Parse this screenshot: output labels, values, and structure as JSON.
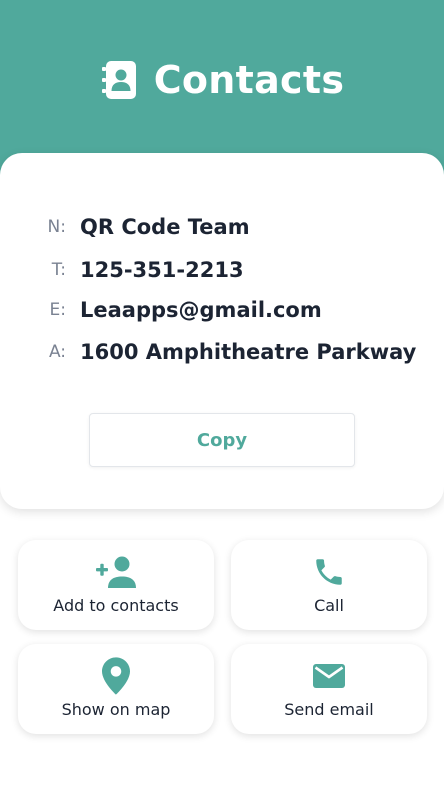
{
  "header": {
    "title": "Contacts",
    "icon": "contacts-book-icon",
    "color": "#50a99c"
  },
  "contact": {
    "fields": [
      {
        "label": "N:",
        "value": "QR Code Team"
      },
      {
        "label": "T:",
        "value": "125-351-2213"
      },
      {
        "label": "E:",
        "value": "Leaapps@gmail.com"
      },
      {
        "label": "A:",
        "value": "1600 Amphitheatre Parkway"
      }
    ],
    "copy_label": "Copy"
  },
  "actions": [
    {
      "label": "Add to contacts",
      "icon": "add-person-icon"
    },
    {
      "label": "Call",
      "icon": "phone-icon"
    },
    {
      "label": "Show on map",
      "icon": "map-pin-icon"
    },
    {
      "label": "Send email",
      "icon": "mail-icon"
    }
  ],
  "colors": {
    "accent": "#50a99c",
    "text": "#1c2433",
    "label": "#7a8292"
  }
}
